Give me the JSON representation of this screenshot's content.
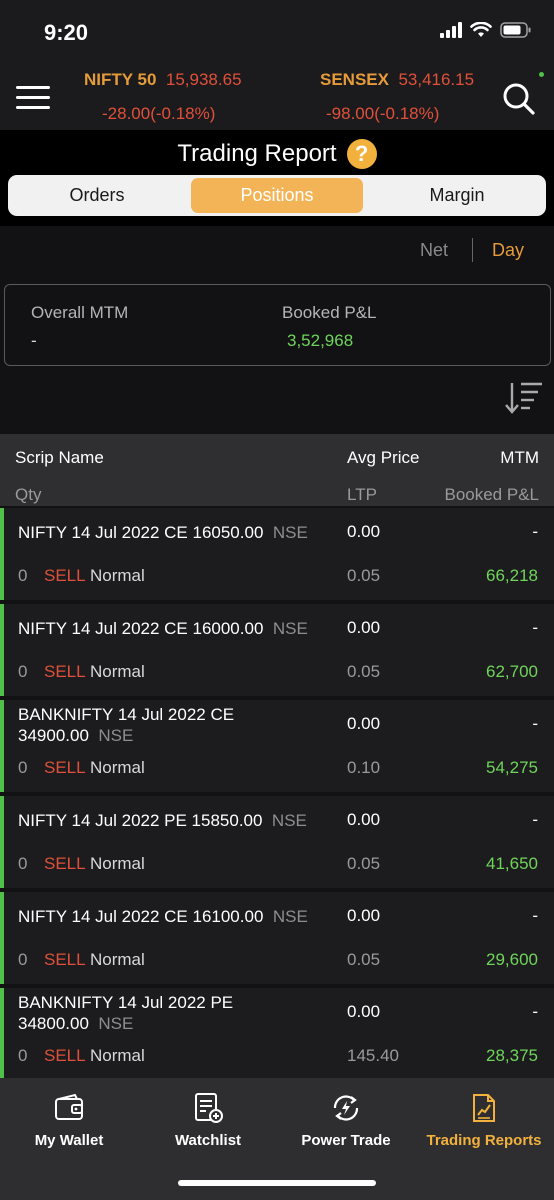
{
  "status": {
    "time": "9:20"
  },
  "ticker": {
    "nifty_name": "NIFTY 50",
    "nifty_value": "15,938.65",
    "nifty_change": "-28.00(-0.18%)",
    "sensex_name": "SENSEX",
    "sensex_value": "53,416.15",
    "sensex_change": "-98.00(-0.18%)"
  },
  "title": "Trading Report",
  "help_glyph": "?",
  "tabs": [
    {
      "label": "Orders",
      "active": false
    },
    {
      "label": "Positions",
      "active": true
    },
    {
      "label": "Margin",
      "active": false
    }
  ],
  "period": {
    "net": "Net",
    "day": "Day",
    "selected": "Day"
  },
  "summary": {
    "mtm_label": "Overall MTM",
    "mtm_value": "-",
    "pnl_label": "Booked P&L",
    "pnl_value": "3,52,968"
  },
  "table_header": {
    "scrip": "Scrip Name",
    "avg_price": "Avg Price",
    "mtm": "MTM",
    "qty": "Qty",
    "ltp": "LTP",
    "booked_pnl": "Booked P&L"
  },
  "rows": [
    {
      "scrip": "NIFTY 14 Jul 2022 CE 16050.00",
      "exchange": "NSE",
      "qty": "0",
      "side": "SELL",
      "product": "Normal",
      "avg": "0.00",
      "ltp": "0.05",
      "mtm": "-",
      "pnl": "66,218"
    },
    {
      "scrip": "NIFTY 14 Jul 2022 CE 16000.00",
      "exchange": "NSE",
      "qty": "0",
      "side": "SELL",
      "product": "Normal",
      "avg": "0.00",
      "ltp": "0.05",
      "mtm": "-",
      "pnl": "62,700"
    },
    {
      "scrip": "BANKNIFTY 14 Jul 2022 CE 34900.00",
      "exchange": "NSE",
      "qty": "0",
      "side": "SELL",
      "product": "Normal",
      "avg": "0.00",
      "ltp": "0.10",
      "mtm": "-",
      "pnl": "54,275"
    },
    {
      "scrip": "NIFTY 14 Jul 2022 PE 15850.00",
      "exchange": "NSE",
      "qty": "0",
      "side": "SELL",
      "product": "Normal",
      "avg": "0.00",
      "ltp": "0.05",
      "mtm": "-",
      "pnl": "41,650"
    },
    {
      "scrip": "NIFTY 14 Jul 2022 CE 16100.00",
      "exchange": "NSE",
      "qty": "0",
      "side": "SELL",
      "product": "Normal",
      "avg": "0.00",
      "ltp": "0.05",
      "mtm": "-",
      "pnl": "29,600"
    },
    {
      "scrip": "BANKNIFTY 14 Jul 2022 PE 34800.00",
      "exchange": "NSE",
      "qty": "0",
      "side": "SELL",
      "product": "Normal",
      "avg": "0.00",
      "ltp": "145.40",
      "mtm": "-",
      "pnl": "28,375"
    }
  ],
  "nav": [
    {
      "label": "My Wallet",
      "icon": "wallet-icon",
      "active": false
    },
    {
      "label": "Watchlist",
      "icon": "watchlist-icon",
      "active": false
    },
    {
      "label": "Power Trade",
      "icon": "power-trade-icon",
      "active": false
    },
    {
      "label": "Trading Reports",
      "icon": "trading-reports-icon",
      "active": true
    }
  ],
  "colors": {
    "accent": "#f3b458",
    "negative": "#e0503a",
    "positive": "#6fd45a",
    "row_bar": "#4fc04a"
  }
}
